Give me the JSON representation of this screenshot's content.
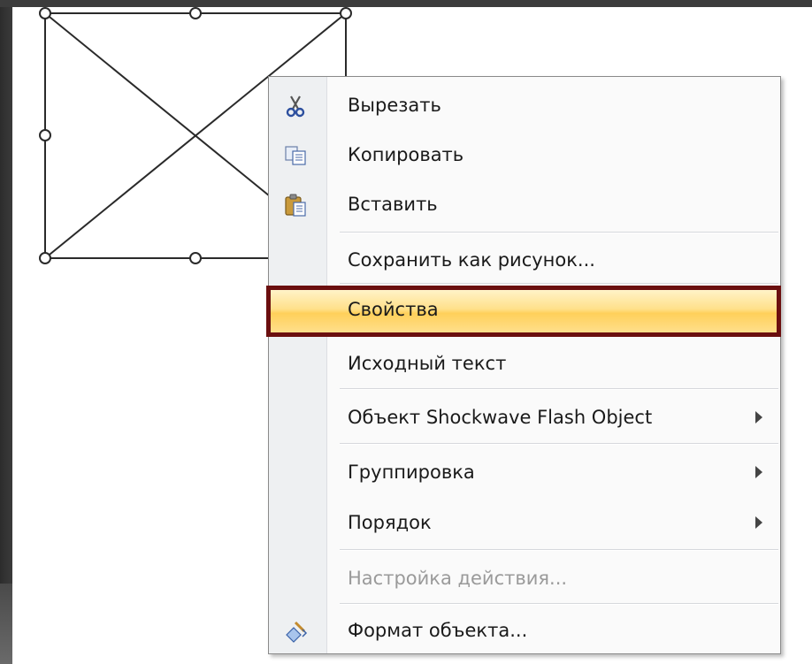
{
  "context_menu": {
    "items": [
      {
        "label": "Вырезать",
        "icon": "scissors-icon",
        "disabled": false,
        "submenu": false
      },
      {
        "label": "Копировать",
        "icon": "copy-icon",
        "disabled": false,
        "submenu": false
      },
      {
        "label": "Вставить",
        "icon": "paste-icon",
        "disabled": false,
        "submenu": false
      },
      {
        "label": "Сохранить как рисунок...",
        "icon": null,
        "disabled": false,
        "submenu": false
      },
      {
        "label": "Свойства",
        "icon": null,
        "disabled": false,
        "submenu": false,
        "selected": true
      },
      {
        "label": "Исходный текст",
        "icon": null,
        "disabled": false,
        "submenu": false
      },
      {
        "label": "Объект Shockwave Flash Object",
        "icon": null,
        "disabled": false,
        "submenu": true
      },
      {
        "label": "Группировка",
        "icon": null,
        "disabled": false,
        "submenu": true
      },
      {
        "label": "Порядок",
        "icon": null,
        "disabled": false,
        "submenu": true
      },
      {
        "label": "Настройка действия...",
        "icon": null,
        "disabled": true,
        "submenu": false
      },
      {
        "label": "Формат объекта...",
        "icon": "format-object-icon",
        "disabled": false,
        "submenu": false
      }
    ]
  },
  "colors": {
    "highlight_border": "#6b0f0f",
    "highlight_fill": "#ffd05a",
    "background": "#3a3a3a"
  }
}
